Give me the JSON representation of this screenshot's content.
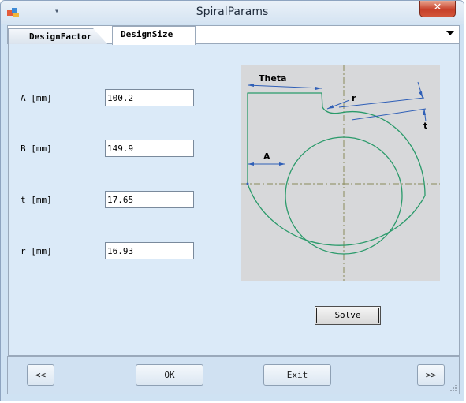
{
  "window": {
    "title": "SpiralParams",
    "close_label": "✕"
  },
  "tabs": [
    {
      "label": "DesignFactor",
      "active": false
    },
    {
      "label": "DesignSize",
      "active": true
    }
  ],
  "fields": [
    {
      "label": "A [mm]",
      "value": "100.2"
    },
    {
      "label": "B [mm]",
      "value": "149.9"
    },
    {
      "label": "t [mm]",
      "value": "17.65"
    },
    {
      "label": "r [mm]",
      "value": "16.93"
    }
  ],
  "figure": {
    "labels": {
      "theta": "Theta",
      "r": "r",
      "t": "t",
      "a": "A"
    }
  },
  "buttons": {
    "solve": "Solve",
    "ok": "OK",
    "exit": "Exit",
    "prev": "<<",
    "next": ">>"
  },
  "colors": {
    "spiral": "#2a9a6a",
    "dimension": "#2f5fb7",
    "centerline": "#8a8a5a"
  },
  "icons": [
    "app-icon",
    "menu-icon",
    "close-icon",
    "dropdown-icon",
    "resize-grip-icon"
  ]
}
